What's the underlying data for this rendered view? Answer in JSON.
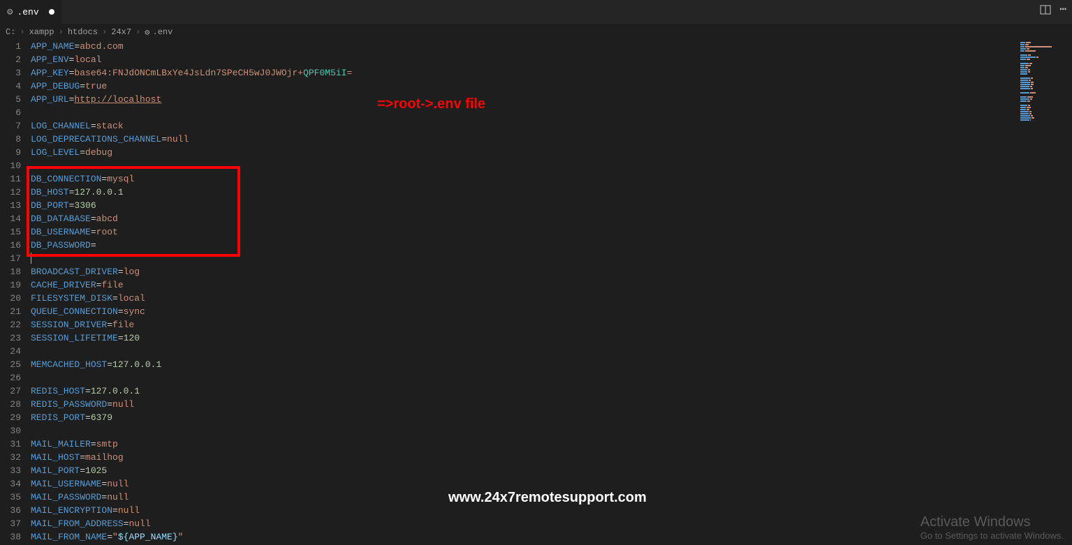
{
  "tab": {
    "filename": ".env"
  },
  "breadcrumbs": [
    "C:",
    "xampp",
    "htdocs",
    "24x7",
    ".env"
  ],
  "annotation": "=>root->.env file",
  "watermark": "www.24x7remotesupport.com",
  "activate_windows": {
    "title": "Activate Windows",
    "sub": "Go to Settings to activate Windows."
  },
  "lines": [
    {
      "n": 1,
      "segs": [
        {
          "t": "APP_NAME",
          "c": "tok-key"
        },
        {
          "t": "=",
          "c": ""
        },
        {
          "t": "abcd.com",
          "c": "tok-val"
        }
      ]
    },
    {
      "n": 2,
      "segs": [
        {
          "t": "APP_ENV",
          "c": "tok-key"
        },
        {
          "t": "=",
          "c": ""
        },
        {
          "t": "local",
          "c": "tok-val"
        }
      ]
    },
    {
      "n": 3,
      "segs": [
        {
          "t": "APP_KEY",
          "c": "tok-key"
        },
        {
          "t": "=",
          "c": ""
        },
        {
          "t": "base64:FNJdONCmLBxYe4JsLdn7SPeCH5wJ0JWOjr+",
          "c": "tok-val"
        },
        {
          "t": "QPF0M5iI",
          "c": "tok-special"
        },
        {
          "t": "=",
          "c": "tok-val"
        }
      ]
    },
    {
      "n": 4,
      "segs": [
        {
          "t": "APP_DEBUG",
          "c": "tok-key"
        },
        {
          "t": "=",
          "c": ""
        },
        {
          "t": "true",
          "c": "tok-val"
        }
      ]
    },
    {
      "n": 5,
      "segs": [
        {
          "t": "APP_URL",
          "c": "tok-key"
        },
        {
          "t": "=",
          "c": ""
        },
        {
          "t": "http://localhost",
          "c": "tok-link"
        }
      ]
    },
    {
      "n": 6,
      "segs": []
    },
    {
      "n": 7,
      "segs": [
        {
          "t": "LOG_CHANNEL",
          "c": "tok-key"
        },
        {
          "t": "=",
          "c": ""
        },
        {
          "t": "stack",
          "c": "tok-val"
        }
      ]
    },
    {
      "n": 8,
      "segs": [
        {
          "t": "LOG_DEPRECATIONS_CHANNEL",
          "c": "tok-key"
        },
        {
          "t": "=",
          "c": ""
        },
        {
          "t": "null",
          "c": "tok-val"
        }
      ]
    },
    {
      "n": 9,
      "segs": [
        {
          "t": "LOG_LEVEL",
          "c": "tok-key"
        },
        {
          "t": "=",
          "c": ""
        },
        {
          "t": "debug",
          "c": "tok-val"
        }
      ]
    },
    {
      "n": 10,
      "segs": []
    },
    {
      "n": 11,
      "segs": [
        {
          "t": "DB_CONNECTION",
          "c": "tok-key"
        },
        {
          "t": "=",
          "c": ""
        },
        {
          "t": "mysql",
          "c": "tok-val"
        }
      ]
    },
    {
      "n": 12,
      "segs": [
        {
          "t": "DB_HOST",
          "c": "tok-key"
        },
        {
          "t": "=",
          "c": ""
        },
        {
          "t": "127.0.0.1",
          "c": "tok-num"
        }
      ]
    },
    {
      "n": 13,
      "segs": [
        {
          "t": "DB_PORT",
          "c": "tok-key"
        },
        {
          "t": "=",
          "c": ""
        },
        {
          "t": "3306",
          "c": "tok-num"
        }
      ]
    },
    {
      "n": 14,
      "segs": [
        {
          "t": "DB_DATABASE",
          "c": "tok-key"
        },
        {
          "t": "=",
          "c": ""
        },
        {
          "t": "abcd",
          "c": "tok-val"
        }
      ]
    },
    {
      "n": 15,
      "segs": [
        {
          "t": "DB_USERNAME",
          "c": "tok-key"
        },
        {
          "t": "=",
          "c": ""
        },
        {
          "t": "root",
          "c": "tok-val"
        }
      ]
    },
    {
      "n": 16,
      "segs": [
        {
          "t": "DB_PASSWORD",
          "c": "tok-key"
        },
        {
          "t": "=",
          "c": ""
        }
      ]
    },
    {
      "n": 17,
      "segs": [],
      "cursor": true
    },
    {
      "n": 18,
      "segs": [
        {
          "t": "BROADCAST_DRIVER",
          "c": "tok-key"
        },
        {
          "t": "=",
          "c": ""
        },
        {
          "t": "log",
          "c": "tok-val"
        }
      ]
    },
    {
      "n": 19,
      "segs": [
        {
          "t": "CACHE_DRIVER",
          "c": "tok-key"
        },
        {
          "t": "=",
          "c": ""
        },
        {
          "t": "file",
          "c": "tok-val"
        }
      ]
    },
    {
      "n": 20,
      "segs": [
        {
          "t": "FILESYSTEM_DISK",
          "c": "tok-key"
        },
        {
          "t": "=",
          "c": ""
        },
        {
          "t": "local",
          "c": "tok-val"
        }
      ]
    },
    {
      "n": 21,
      "segs": [
        {
          "t": "QUEUE_CONNECTION",
          "c": "tok-key"
        },
        {
          "t": "=",
          "c": ""
        },
        {
          "t": "sync",
          "c": "tok-val"
        }
      ]
    },
    {
      "n": 22,
      "segs": [
        {
          "t": "SESSION_DRIVER",
          "c": "tok-key"
        },
        {
          "t": "=",
          "c": ""
        },
        {
          "t": "file",
          "c": "tok-val"
        }
      ]
    },
    {
      "n": 23,
      "segs": [
        {
          "t": "SESSION_LIFETIME",
          "c": "tok-key"
        },
        {
          "t": "=",
          "c": ""
        },
        {
          "t": "120",
          "c": "tok-num"
        }
      ]
    },
    {
      "n": 24,
      "segs": []
    },
    {
      "n": 25,
      "segs": [
        {
          "t": "MEMCACHED_HOST",
          "c": "tok-key"
        },
        {
          "t": "=",
          "c": ""
        },
        {
          "t": "127.0.0.1",
          "c": "tok-num"
        }
      ]
    },
    {
      "n": 26,
      "segs": []
    },
    {
      "n": 27,
      "segs": [
        {
          "t": "REDIS_HOST",
          "c": "tok-key"
        },
        {
          "t": "=",
          "c": ""
        },
        {
          "t": "127.0.0.1",
          "c": "tok-num"
        }
      ]
    },
    {
      "n": 28,
      "segs": [
        {
          "t": "REDIS_PASSWORD",
          "c": "tok-key"
        },
        {
          "t": "=",
          "c": ""
        },
        {
          "t": "null",
          "c": "tok-val"
        }
      ]
    },
    {
      "n": 29,
      "segs": [
        {
          "t": "REDIS_PORT",
          "c": "tok-key"
        },
        {
          "t": "=",
          "c": ""
        },
        {
          "t": "6379",
          "c": "tok-num"
        }
      ]
    },
    {
      "n": 30,
      "segs": []
    },
    {
      "n": 31,
      "segs": [
        {
          "t": "MAIL_MAILER",
          "c": "tok-key"
        },
        {
          "t": "=",
          "c": ""
        },
        {
          "t": "smtp",
          "c": "tok-val"
        }
      ]
    },
    {
      "n": 32,
      "segs": [
        {
          "t": "MAIL_HOST",
          "c": "tok-key"
        },
        {
          "t": "=",
          "c": ""
        },
        {
          "t": "mailhog",
          "c": "tok-val"
        }
      ]
    },
    {
      "n": 33,
      "segs": [
        {
          "t": "MAIL_PORT",
          "c": "tok-key"
        },
        {
          "t": "=",
          "c": ""
        },
        {
          "t": "1025",
          "c": "tok-num"
        }
      ]
    },
    {
      "n": 34,
      "segs": [
        {
          "t": "MAIL_USERNAME",
          "c": "tok-key"
        },
        {
          "t": "=",
          "c": ""
        },
        {
          "t": "null",
          "c": "tok-val"
        }
      ]
    },
    {
      "n": 35,
      "segs": [
        {
          "t": "MAIL_PASSWORD",
          "c": "tok-key"
        },
        {
          "t": "=",
          "c": ""
        },
        {
          "t": "null",
          "c": "tok-val"
        }
      ]
    },
    {
      "n": 36,
      "segs": [
        {
          "t": "MAIL_ENCRYPTION",
          "c": "tok-key"
        },
        {
          "t": "=",
          "c": ""
        },
        {
          "t": "null",
          "c": "tok-val"
        }
      ]
    },
    {
      "n": 37,
      "segs": [
        {
          "t": "MAIL_FROM_ADDRESS",
          "c": "tok-key"
        },
        {
          "t": "=",
          "c": ""
        },
        {
          "t": "null",
          "c": "tok-val"
        }
      ]
    },
    {
      "n": 38,
      "segs": [
        {
          "t": "MAIL_FROM_NAME",
          "c": "tok-key"
        },
        {
          "t": "=",
          "c": ""
        },
        {
          "t": "\"",
          "c": "tok-val"
        },
        {
          "t": "${APP_NAME}",
          "c": "tok-var"
        },
        {
          "t": "\"",
          "c": "tok-val"
        }
      ]
    }
  ]
}
